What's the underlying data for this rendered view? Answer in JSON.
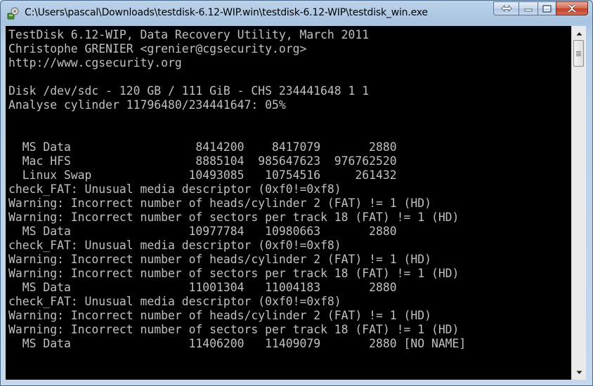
{
  "window": {
    "title": "C:\\Users\\pascal\\Downloads\\testdisk-6.12-WIP.win\\testdisk-6.12-WIP\\testdisk_win.exe",
    "icon": "testdisk-app-icon",
    "buttons": [
      "swap-button",
      "minimize-button",
      "maximize-button",
      "close-button"
    ]
  },
  "console": {
    "text_color": "#c0c0c0",
    "background": "#000000",
    "lines": [
      "TestDisk 6.12-WIP, Data Recovery Utility, March 2011",
      "Christophe GRENIER <grenier@cgsecurity.org>",
      "http://www.cgsecurity.org",
      "",
      "Disk /dev/sdc - 120 GB / 111 GiB - CHS 234441648 1 1",
      "Analyse cylinder 11796480/234441647: 05%",
      "",
      "",
      "  MS Data                  8414200    8417079       2880",
      "  Mac HFS                  8885104  985647623  976762520",
      "  Linux Swap              10493085   10754516     261432",
      "check_FAT: Unusual media descriptor (0xf0!=0xf8)",
      "Warning: Incorrect number of heads/cylinder 2 (FAT) != 1 (HD)",
      "Warning: Incorrect number of sectors per track 18 (FAT) != 1 (HD)",
      "  MS Data                 10977784   10980663       2880",
      "check_FAT: Unusual media descriptor (0xf0!=0xf8)",
      "Warning: Incorrect number of heads/cylinder 2 (FAT) != 1 (HD)",
      "Warning: Incorrect number of sectors per track 18 (FAT) != 1 (HD)",
      "  MS Data                 11001304   11004183       2880",
      "check_FAT: Unusual media descriptor (0xf0!=0xf8)",
      "Warning: Incorrect number of heads/cylinder 2 (FAT) != 1 (HD)",
      "Warning: Incorrect number of sectors per track 18 (FAT) != 1 (HD)",
      "  MS Data                 11406200   11409079       2880 [NO NAME]"
    ]
  },
  "scrollbar": {
    "up_icon": "scroll-up-arrow-icon",
    "down_icon": "scroll-down-arrow-icon"
  }
}
